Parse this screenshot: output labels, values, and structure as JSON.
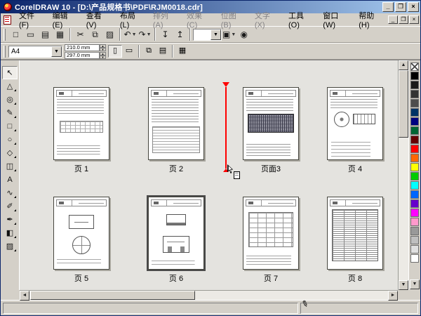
{
  "window": {
    "title": "CorelDRAW 10 - [D:\\产品规格书\\PDF\\RJM0018.cdr]",
    "buttons": {
      "minimize": "_",
      "restore": "❐",
      "close": "×"
    }
  },
  "menu": {
    "items": [
      {
        "name": "file",
        "label": "文件(F)",
        "enabled": true
      },
      {
        "name": "edit",
        "label": "编辑(E)",
        "enabled": true
      },
      {
        "name": "view",
        "label": "查看(V)",
        "enabled": true
      },
      {
        "name": "layout",
        "label": "布局(L)",
        "enabled": true
      },
      {
        "name": "arrange",
        "label": "排列(A)",
        "enabled": false
      },
      {
        "name": "effects",
        "label": "效果(C)",
        "enabled": false
      },
      {
        "name": "bitmaps",
        "label": "位图(B)",
        "enabled": false
      },
      {
        "name": "text",
        "label": "文字(X)",
        "enabled": false
      },
      {
        "name": "tools",
        "label": "工具(O)",
        "enabled": true
      },
      {
        "name": "window",
        "label": "窗口(W)",
        "enabled": true
      },
      {
        "name": "help",
        "label": "帮助(H)",
        "enabled": true
      }
    ],
    "mdi_buttons": {
      "minimize": "_",
      "restore": "❐",
      "close": "×"
    }
  },
  "standard_toolbar": [
    {
      "name": "new-button",
      "glyph": "□"
    },
    {
      "name": "open-button",
      "glyph": "▭"
    },
    {
      "name": "save-button",
      "glyph": "▤"
    },
    {
      "name": "print-button",
      "glyph": "▦",
      "group_end": true
    },
    {
      "name": "cut-button",
      "glyph": "✂"
    },
    {
      "name": "copy-button",
      "glyph": "⧉"
    },
    {
      "name": "paste-button",
      "glyph": "▨",
      "group_end": true
    },
    {
      "name": "undo-button",
      "glyph": "↶",
      "dropdown": true
    },
    {
      "name": "redo-button",
      "glyph": "↷",
      "dropdown": true,
      "group_end": true
    },
    {
      "name": "import-button",
      "glyph": "↧"
    },
    {
      "name": "export-button",
      "glyph": "↥",
      "group_end": true
    },
    {
      "name": "zoom-level-combo",
      "type": "combo",
      "value": ""
    },
    {
      "name": "application-launcher-button",
      "glyph": "▣",
      "dropdown": true
    },
    {
      "name": "corel-online-button",
      "glyph": "◉"
    }
  ],
  "property_bar": {
    "paper_size": "A4",
    "paper_width": "210.0 mm",
    "paper_height": "297.0 mm",
    "buttons": [
      {
        "name": "portrait-button",
        "glyph": "▯",
        "active": true
      },
      {
        "name": "landscape-button",
        "glyph": "▭",
        "active": false
      },
      {
        "name": "all-pages-button",
        "glyph": "⧉",
        "active": false
      },
      {
        "name": "current-page-button",
        "glyph": "▤",
        "active": false
      },
      {
        "name": "options-button",
        "glyph": "▦",
        "active": false
      }
    ]
  },
  "toolbox": [
    {
      "name": "pick-tool",
      "glyph": "↖",
      "active": true
    },
    {
      "name": "shape-tool",
      "glyph": "△",
      "flyout": true
    },
    {
      "name": "zoom-tool",
      "glyph": "◎",
      "flyout": true
    },
    {
      "name": "freehand-tool",
      "glyph": "✎",
      "flyout": true
    },
    {
      "name": "rectangle-tool",
      "glyph": "□",
      "flyout": true
    },
    {
      "name": "ellipse-tool",
      "glyph": "○",
      "flyout": true
    },
    {
      "name": "polygon-tool",
      "glyph": "◇",
      "flyout": true
    },
    {
      "name": "basic-shapes-tool",
      "glyph": "◫",
      "flyout": true
    },
    {
      "name": "text-tool",
      "glyph": "A"
    },
    {
      "name": "interactive-blend-tool",
      "glyph": "∿",
      "flyout": true
    },
    {
      "name": "eyedropper-tool",
      "glyph": "✐",
      "flyout": true
    },
    {
      "name": "outline-tool",
      "glyph": "✒",
      "flyout": true
    },
    {
      "name": "fill-tool",
      "glyph": "◧",
      "flyout": true
    },
    {
      "name": "interactive-fill-tool",
      "glyph": "▨",
      "flyout": true
    }
  ],
  "pages": [
    {
      "name": "page-1",
      "label": "页 1",
      "content": "p1",
      "selected": false
    },
    {
      "name": "page-2",
      "label": "页 2",
      "content": "p2",
      "selected": false
    },
    {
      "name": "page-3",
      "label": "页面3",
      "content": "p3",
      "selected": false,
      "moving": true
    },
    {
      "name": "page-4",
      "label": "页 4",
      "content": "p4",
      "selected": false
    },
    {
      "name": "page-5",
      "label": "页 5",
      "content": "p5",
      "selected": false
    },
    {
      "name": "page-6",
      "label": "页 6",
      "content": "p6",
      "selected": true
    },
    {
      "name": "page-7",
      "label": "页 7",
      "content": "p7",
      "selected": false
    },
    {
      "name": "page-8",
      "label": "页 8",
      "content": "p8",
      "selected": false
    }
  ],
  "palette": {
    "colors": [
      "none",
      "#000000",
      "#1a1a1a",
      "#333333",
      "#4d4d4d",
      "#003366",
      "#000080",
      "#006633",
      "#660000",
      "#ff0000",
      "#ff6600",
      "#ffff00",
      "#00cc00",
      "#00ffff",
      "#0066ff",
      "#6600cc",
      "#ff00ff",
      "#ff99cc",
      "#999999",
      "#bfbfbf",
      "#e0e0e0",
      "#ffffff"
    ]
  },
  "scrollbars": {
    "up": "▲",
    "down": "▼",
    "left": "◄",
    "right": "►",
    "palette_down": "▼"
  },
  "statusbar": {
    "left": "",
    "right": ""
  },
  "colors": {
    "titlebar_start": "#0a246a",
    "titlebar_end": "#a6caf0",
    "chrome": "#d4d0c8",
    "canvas_bg": "#e4e3df",
    "insertion_line": "#ff0000"
  }
}
